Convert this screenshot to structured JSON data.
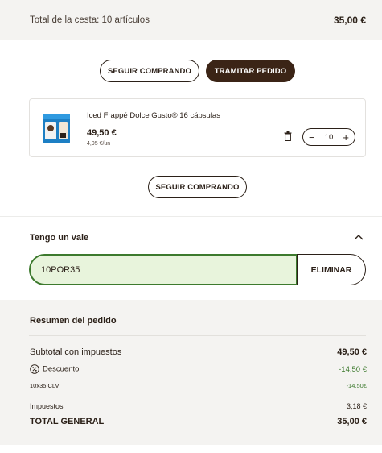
{
  "basket": {
    "label": "Total de la cesta: 10 artículos",
    "total": "35,00 €"
  },
  "actions": {
    "continue_label": "SEGUIR COMPRANDO",
    "checkout_label": "TRAMITAR PEDIDO"
  },
  "product": {
    "name": "Iced Frappé Dolce Gusto® 16 cápsulas",
    "price": "49,50 €",
    "unit_price": "4,95 €/un",
    "quantity": "10",
    "minus": "−",
    "plus": "+",
    "icon": "trash-icon"
  },
  "continue_bottom_label": "SEGUIR COMPRANDO",
  "voucher": {
    "title": "Tengo un vale",
    "code": "10POR35",
    "remove_label": "ELIMINAR"
  },
  "summary": {
    "title": "Resumen del pedido",
    "subtotal_label": "Subtotal con impuestos",
    "subtotal_value": "49,50 €",
    "discount_label": "Descuento",
    "discount_value": "-14,50 €",
    "coupon_label": "10x35 CLV",
    "coupon_value": "-14.50€",
    "taxes_label": "Impuestos",
    "taxes_value": "3,18 €",
    "total_label": "TOTAL GENERAL",
    "total_value": "35,00 €"
  },
  "colors": {
    "brand_dark": "#3b2416",
    "voucher_green": "#3d7a2e",
    "voucher_bg": "#e8f4dc",
    "panel_bg": "#f4f3f1"
  }
}
